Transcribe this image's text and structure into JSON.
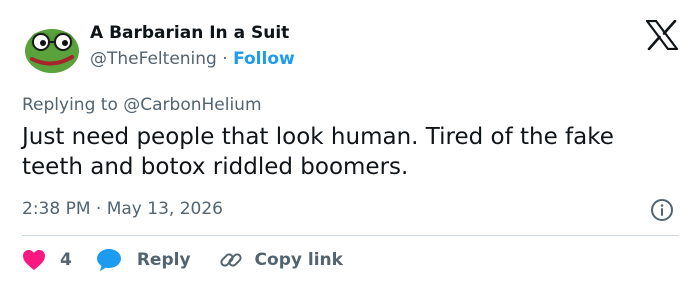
{
  "author": {
    "name": "A Barbarian In a Suit",
    "handle": "@TheFeltening",
    "separator": "·",
    "follow_label": "Follow"
  },
  "tweet": {
    "replying_prefix": "Replying to",
    "replying_to": "@CarbonHelium",
    "text": "Just need people that look human. Tired of the fake teeth and botox riddled boomers.",
    "time": "2:38 PM",
    "separator": "·",
    "date": "May 13, 2026"
  },
  "actions": {
    "like_count": "4",
    "reply_label": "Reply",
    "copy_label": "Copy link"
  },
  "colors": {
    "accent": "#1d9bf0",
    "like": "#f91880",
    "muted": "#536471",
    "divider": "#cfd9de"
  },
  "icons": [
    "avatar-pepe",
    "x-logo-icon",
    "info-icon",
    "heart-icon",
    "reply-bubble-icon",
    "link-icon"
  ]
}
